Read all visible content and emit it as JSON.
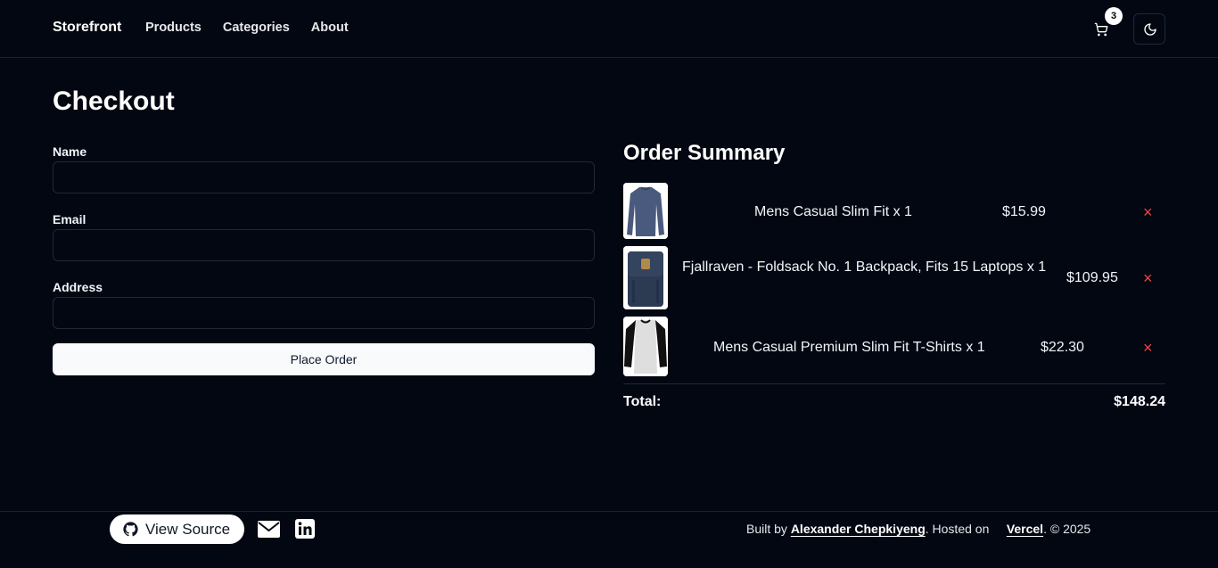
{
  "header": {
    "brand": "Storefront",
    "nav": [
      "Products",
      "Categories",
      "About"
    ],
    "cart_count": "3",
    "icons": {
      "cart": "shopping-cart-icon",
      "theme": "moon-icon"
    }
  },
  "checkout": {
    "title": "Checkout",
    "fields": [
      {
        "label": "Name",
        "value": "",
        "placeholder": ""
      },
      {
        "label": "Email",
        "value": "",
        "placeholder": ""
      },
      {
        "label": "Address",
        "value": "",
        "placeholder": ""
      }
    ],
    "submit_label": "Place Order"
  },
  "summary": {
    "title": "Order Summary",
    "items": [
      {
        "name": "Mens Casual Slim Fit x 1",
        "price": "$15.99",
        "remove": "×",
        "image": "long-sleeve-shirt"
      },
      {
        "name": "Fjallraven - Foldsack No. 1 Backpack, Fits 15 Laptops x 1",
        "price": "$109.95",
        "remove": "×",
        "image": "backpack"
      },
      {
        "name": "Mens Casual Premium Slim Fit T-Shirts x 1",
        "price": "$22.30",
        "remove": "×",
        "image": "raglan-shirt"
      }
    ],
    "total_label": "Total:",
    "total_value": "$148.24"
  },
  "footer": {
    "view_source": "View Source",
    "built_by": "Built by ",
    "author": "Alexander Chepkiyeng",
    "hosted_on": ". Hosted on",
    "host": "Vercel",
    "copyright": ". © 2025",
    "icons": {
      "source": "github-icon",
      "mail": "mail-icon",
      "linkedin": "linkedin-icon"
    }
  },
  "colors": {
    "background": "#030712",
    "remove": "#ef4444",
    "button": "#f8fafc"
  }
}
